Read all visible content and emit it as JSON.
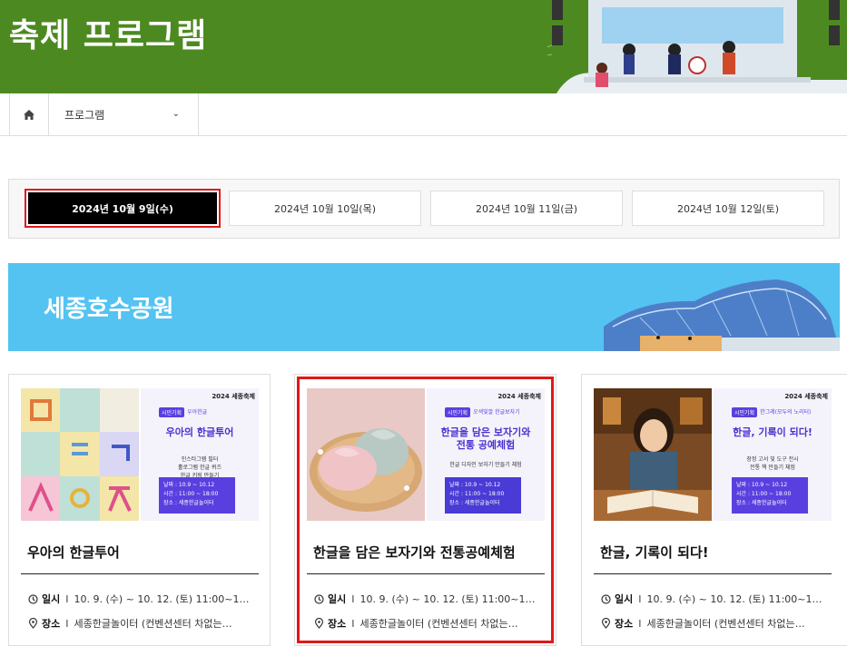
{
  "header": {
    "title": "축제 프로그램"
  },
  "breadcrumb": {
    "home_icon": "home-icon",
    "current": "프로그램"
  },
  "dates": [
    {
      "label": "2024년 10월 9일(수)",
      "active": true
    },
    {
      "label": "2024년 10월 10일(목)",
      "active": false
    },
    {
      "label": "2024년 10월 11일(금)",
      "active": false
    },
    {
      "label": "2024년 10월 12일(토)",
      "active": false
    }
  ],
  "location": {
    "title": "세종호수공원"
  },
  "cards": [
    {
      "title": "우아의 한글투어",
      "promo": {
        "brand": "2024 세종축제",
        "tag": "시민기획",
        "subtag": "우아한글",
        "title": "우아의 한글투어",
        "desc": [
          "인스타그램 필터",
          "홀로그램 한글 퀴즈",
          "한글 키링 만들기"
        ],
        "info": [
          "날짜 : 10.9 ~ 10.12",
          "시간 : 11:00 ~ 18:00",
          "장소 : 세종한글놀이터"
        ]
      },
      "date_label": "일시",
      "date_value": "10. 9. (수) ~ 10. 12. (토) 11:00~1…",
      "place_label": "장소",
      "place_value": "세종한글놀이터 (컨벤션센터 차없는…"
    },
    {
      "title": "한글을 담은 보자기와 전통공예체험",
      "promo": {
        "brand": "2024 세종축제",
        "tag": "시민기획",
        "subtag": "오색빛깔 한글보자기",
        "title": "한글을 담은 보자기와 전통 공예체험",
        "desc": [
          "한글 디자인 보자기 만들기 체험"
        ],
        "info": [
          "날짜 : 10.9 ~ 10.12",
          "시간 : 11:00 ~ 18:00",
          "장소 : 세종한글놀이터"
        ]
      },
      "date_label": "일시",
      "date_value": "10. 9. (수) ~ 10. 12. (토) 11:00~1…",
      "place_label": "장소",
      "place_value": "세종한글놀이터 (컨벤션센터 차없는…"
    },
    {
      "title": "한글, 기록이 되다!",
      "promo": {
        "brand": "2024 세종축제",
        "tag": "시민기획",
        "subtag": "한그레(모두의 노리터)",
        "title": "한글, 기록이 되다!",
        "desc": [
          "장정 고서 및 도구 전시",
          "전통 책 만들기 체험"
        ],
        "info": [
          "날짜 : 10.9 ~ 10.12",
          "시간 : 11:00 ~ 18:00",
          "장소 : 세종한글놀이터"
        ]
      },
      "date_label": "일시",
      "date_value": "10. 9. (수) ~ 10. 12. (토) 11:00~1…",
      "place_label": "장소",
      "place_value": "세종한글놀이터 (컨벤션센터 차없는…"
    }
  ]
}
